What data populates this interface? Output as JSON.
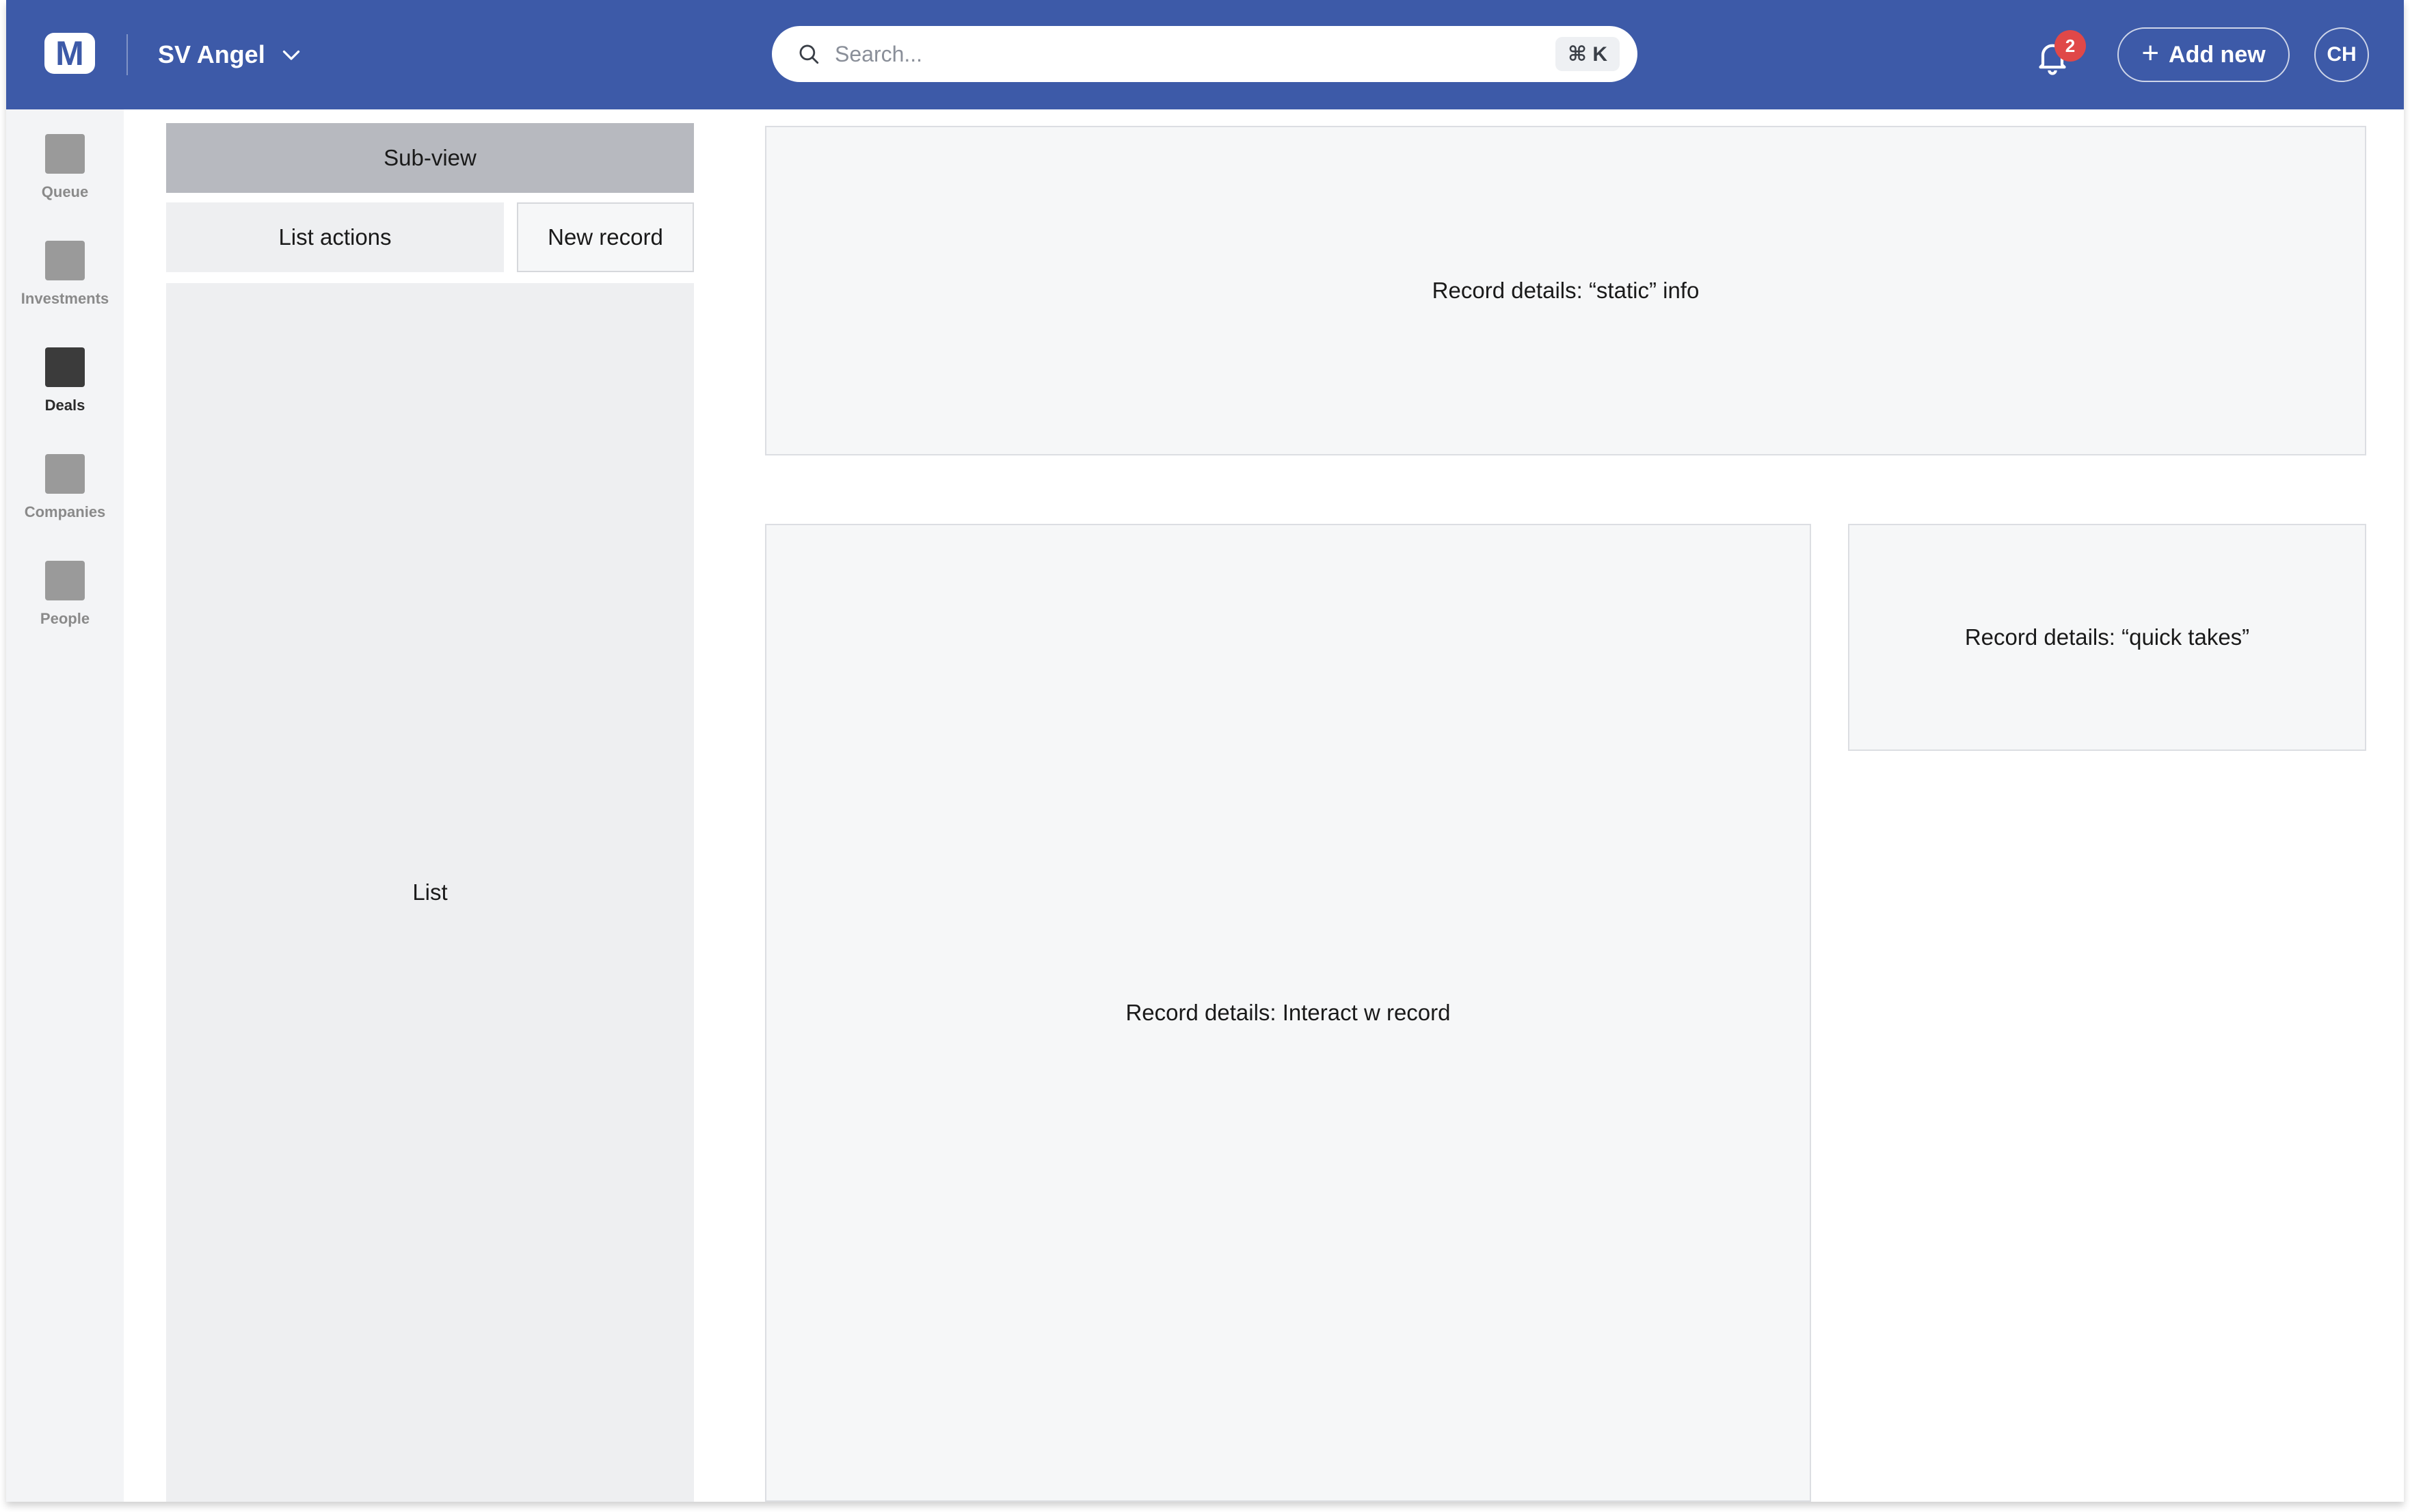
{
  "header": {
    "logo_letter": "M",
    "org_name": "SV Angel",
    "search": {
      "placeholder": "Search...",
      "shortcut": "⌘ K"
    },
    "notifications_count": "2",
    "add_new_label": "Add new",
    "avatar_initials": "CH",
    "brand_color": "#3d5aa8",
    "badge_color": "#e04848"
  },
  "sidebar": {
    "items": [
      {
        "label": "Queue",
        "active": false
      },
      {
        "label": "Investments",
        "active": false
      },
      {
        "label": "Deals",
        "active": true
      },
      {
        "label": "Companies",
        "active": false
      },
      {
        "label": "People",
        "active": false
      }
    ]
  },
  "left_column": {
    "subview_label": "Sub-view",
    "list_actions_label": "List actions",
    "new_record_label": "New record",
    "list_label": "List"
  },
  "panels": {
    "static_info": "Record details: “static” info",
    "interact": "Record details: Interact w record",
    "quick_takes": "Record details: “quick takes”"
  }
}
